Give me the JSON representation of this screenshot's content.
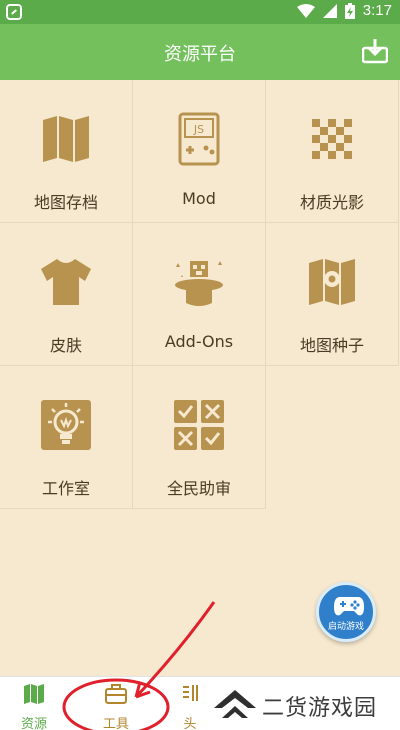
{
  "status_bar": {
    "time": "3:17"
  },
  "header": {
    "title": "资源平台"
  },
  "grid": [
    {
      "label": "地图存档",
      "icon": "map-icon"
    },
    {
      "label": "Mod",
      "icon": "mod-device-icon",
      "badge": "JS"
    },
    {
      "label": "材质光影",
      "icon": "checker-texture-icon"
    },
    {
      "label": "皮肤",
      "icon": "shirt-icon"
    },
    {
      "label": "Add-Ons",
      "icon": "magic-hat-icon"
    },
    {
      "label": "地图种子",
      "icon": "map-pin-icon"
    },
    {
      "label": "工作室",
      "icon": "studio-bulb-icon"
    },
    {
      "label": "全民助审",
      "icon": "review-grid-icon"
    }
  ],
  "fab": {
    "label": "启动游戏"
  },
  "bottom_nav": [
    {
      "label": "资源",
      "icon": "map-icon",
      "active": true
    },
    {
      "label": "工具",
      "icon": "toolbox-icon",
      "active": false
    },
    {
      "label": "头",
      "icon": "avatar-icon",
      "active": false
    }
  ],
  "watermark": {
    "text": "二货游戏园"
  },
  "colors": {
    "header": "#73c05d",
    "statusbar": "#5bab4a",
    "background": "#f6e9cf",
    "icon": "#b8934f",
    "annotation": "#e0202a"
  }
}
